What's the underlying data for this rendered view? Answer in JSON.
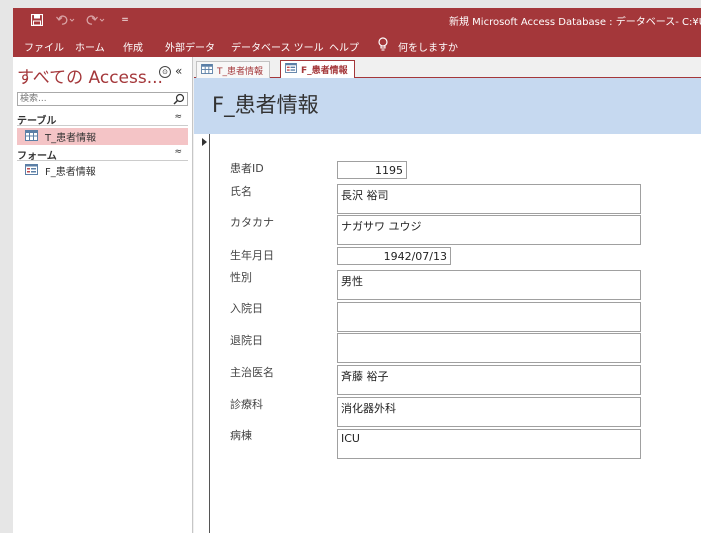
{
  "window": {
    "title": "新規 Microsoft Access Database : データベース- C:¥Use",
    "qat_custom": "="
  },
  "menu": {
    "items": [
      {
        "label": "ファイル"
      },
      {
        "label": "ホーム"
      },
      {
        "label": "作成"
      },
      {
        "label": "外部データ"
      },
      {
        "label": "データベース ツール"
      },
      {
        "label": "ヘルプ"
      },
      {
        "label": "何をしますか"
      }
    ]
  },
  "nav": {
    "title": "すべての Access...",
    "dropdown_glyph": "⊙",
    "shutter_glyph": "«",
    "search_placeholder": "検索...",
    "groups": [
      {
        "label": "テーブル",
        "chevron": "≈",
        "items": [
          {
            "label": "T_患者情報",
            "icon": "table-icon",
            "selected": true
          }
        ]
      },
      {
        "label": "フォーム",
        "chevron": "≈",
        "items": [
          {
            "label": "F_患者情報",
            "icon": "form-icon",
            "selected": false
          }
        ]
      }
    ]
  },
  "tabs": [
    {
      "label": "T_患者情報",
      "icon": "table-icon",
      "active": false
    },
    {
      "label": "F_患者情報",
      "icon": "form-icon",
      "active": true
    }
  ],
  "form": {
    "title": "F_患者情報",
    "fields": [
      {
        "label": "患者ID",
        "value": "1195"
      },
      {
        "label": "氏名",
        "value": "長沢 裕司"
      },
      {
        "label": "カタカナ",
        "value": "ナガサワ ユウジ"
      },
      {
        "label": "生年月日",
        "value": "1942/07/13"
      },
      {
        "label": "性別",
        "value": "男性"
      },
      {
        "label": "入院日",
        "value": ""
      },
      {
        "label": "退院日",
        "value": ""
      },
      {
        "label": "主治医名",
        "value": "斉藤 裕子"
      },
      {
        "label": "診療科",
        "value": "消化器外科"
      },
      {
        "label": "病棟",
        "value": "ICU"
      }
    ]
  },
  "colors": {
    "accent": "#a4373a",
    "form_header": "#c6d9f0",
    "selected_nav": "#f4c4c6"
  }
}
